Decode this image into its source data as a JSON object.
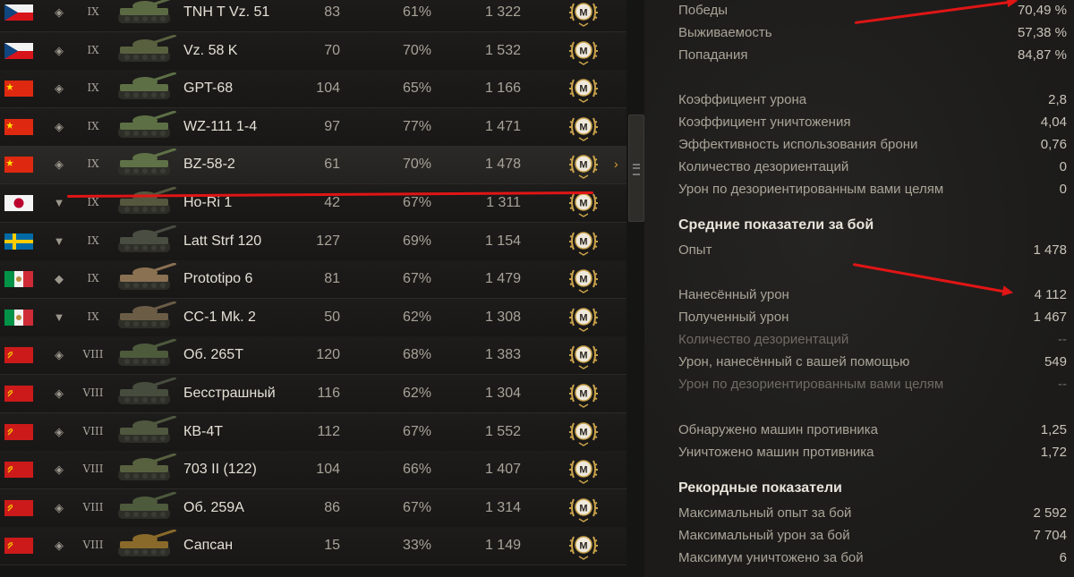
{
  "tanks": [
    {
      "flag": "cz",
      "class": "heavy",
      "tier": "IX",
      "name": "TNH T Vz. 51",
      "battles": "83",
      "winrate": "61%",
      "avg_exp": "1 322",
      "camo": "#5c6a44"
    },
    {
      "flag": "cz",
      "class": "heavy",
      "tier": "IX",
      "name": "Vz. 58 K",
      "battles": "70",
      "winrate": "70%",
      "avg_exp": "1 532",
      "camo": "#59603f"
    },
    {
      "flag": "cn",
      "class": "heavy",
      "tier": "IX",
      "name": "GPT-68",
      "battles": "104",
      "winrate": "65%",
      "avg_exp": "1 166",
      "camo": "#5d7045"
    },
    {
      "flag": "cn",
      "class": "heavy",
      "tier": "IX",
      "name": "WZ-111 1-4",
      "battles": "97",
      "winrate": "77%",
      "avg_exp": "1 471",
      "camo": "#5d7045"
    },
    {
      "flag": "cn",
      "class": "heavy",
      "tier": "IX",
      "name": "BZ-58-2",
      "battles": "61",
      "winrate": "70%",
      "avg_exp": "1 478",
      "camo": "#5f7247"
    },
    {
      "flag": "jp",
      "class": "td",
      "tier": "IX",
      "name": "Ho-Ri 1",
      "battles": "42",
      "winrate": "67%",
      "avg_exp": "1 311",
      "camo": "#55573e"
    },
    {
      "flag": "se",
      "class": "td",
      "tier": "IX",
      "name": "Latt Strf 120",
      "battles": "127",
      "winrate": "69%",
      "avg_exp": "1 154",
      "camo": "#4a4d42"
    },
    {
      "flag": "it",
      "class": "medium",
      "tier": "IX",
      "name": "Prototipo 6",
      "battles": "81",
      "winrate": "67%",
      "avg_exp": "1 479",
      "camo": "#8a7152"
    },
    {
      "flag": "it",
      "class": "td",
      "tier": "IX",
      "name": "CC-1 Mk. 2",
      "battles": "50",
      "winrate": "62%",
      "avg_exp": "1 308",
      "camo": "#6b5c46"
    },
    {
      "flag": "ussr",
      "class": "heavy",
      "tier": "VIII",
      "name": "Об. 265Т",
      "battles": "120",
      "winrate": "68%",
      "avg_exp": "1 383",
      "camo": "#4d5a3c"
    },
    {
      "flag": "ussr",
      "class": "heavy",
      "tier": "VIII",
      "name": "Бесстрашный",
      "battles": "116",
      "winrate": "62%",
      "avg_exp": "1 304",
      "camo": "#474d3e"
    },
    {
      "flag": "ussr",
      "class": "heavy",
      "tier": "VIII",
      "name": "КВ-4Т",
      "battles": "112",
      "winrate": "67%",
      "avg_exp": "1 552",
      "camo": "#4f583f"
    },
    {
      "flag": "ussr",
      "class": "heavy",
      "tier": "VIII",
      "name": "703 II (122)",
      "battles": "104",
      "winrate": "66%",
      "avg_exp": "1 407",
      "camo": "#58613f"
    },
    {
      "flag": "ussr",
      "class": "heavy",
      "tier": "VIII",
      "name": "Об. 259А",
      "battles": "86",
      "winrate": "67%",
      "avg_exp": "1 314",
      "camo": "#4d5a3c"
    },
    {
      "flag": "ussr",
      "class": "heavy",
      "tier": "VIII",
      "name": "Сапсан",
      "battles": "15",
      "winrate": "33%",
      "avg_exp": "1 149",
      "camo": "#8a6a2a"
    }
  ],
  "mastery_letter": "M",
  "selected_marker": "›",
  "stats_top": [
    {
      "label": "Победы",
      "value": "70,49 %"
    },
    {
      "label": "Выживаемость",
      "value": "57,38 %"
    },
    {
      "label": "Попадания",
      "value": "84,87 %"
    }
  ],
  "stats_coef": [
    {
      "label": "Коэффициент урона",
      "value": "2,8"
    },
    {
      "label": "Коэффициент уничтожения",
      "value": "4,04"
    },
    {
      "label": "Эффективность использования брони",
      "value": "0,76"
    },
    {
      "label": "Количество дезориентаций",
      "value": "0"
    },
    {
      "label": "Урон по дезориентированным вами целям",
      "value": "0"
    }
  ],
  "avg_section": {
    "title": "Средние показатели за бой",
    "exp": {
      "label": "Опыт",
      "value": "1 478"
    },
    "damage": [
      {
        "label": "Нанесённый урон",
        "value": "4 112",
        "dim": false
      },
      {
        "label": "Полученный урон",
        "value": "1 467",
        "dim": false
      },
      {
        "label": "Количество дезориентаций",
        "value": "--",
        "dim": true
      },
      {
        "label": "Урон, нанесённый с вашей помощью",
        "value": "549",
        "dim": false
      },
      {
        "label": "Урон по дезориентированным вами целям",
        "value": "--",
        "dim": true
      }
    ],
    "spot": [
      {
        "label": "Обнаружено машин противника",
        "value": "1,25"
      },
      {
        "label": "Уничтожено машин противника",
        "value": "1,72"
      }
    ]
  },
  "record_section": {
    "title": "Рекордные показатели",
    "items": [
      {
        "label": "Максимальный опыт за бой",
        "value": "2 592"
      },
      {
        "label": "Максимальный урон за бой",
        "value": "7 704"
      },
      {
        "label": "Максимум уничтожено за бой",
        "value": "6"
      }
    ]
  },
  "colors": {
    "annotation_red": "#e01515",
    "selected_arrow": "#e0a030",
    "mastery_gold": "#c9a24a"
  }
}
